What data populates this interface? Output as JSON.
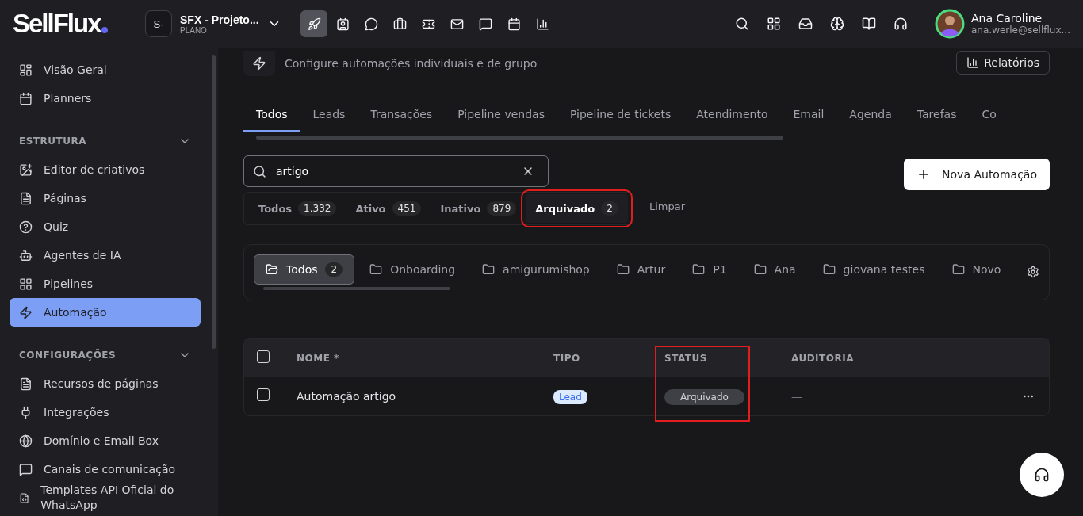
{
  "brand": {
    "logo": "SellFlux"
  },
  "workspace": {
    "initials": "S-",
    "name": "SFX - Projeto...",
    "plan": "PLANO"
  },
  "app_nav": [
    {
      "selected": true
    },
    {
      "selected": false
    },
    {
      "selected": false
    },
    {
      "selected": false
    },
    {
      "selected": false
    },
    {
      "selected": false
    },
    {
      "selected": false
    },
    {
      "selected": false
    },
    {
      "selected": false
    }
  ],
  "user": {
    "name": "Ana Caroline",
    "email": "ana.werle@sellflux..."
  },
  "sidebar": {
    "items": [
      {
        "kind": "item",
        "label": "Visão Geral",
        "selected": false
      },
      {
        "kind": "item",
        "label": "Planners",
        "selected": false
      },
      {
        "kind": "section",
        "label": "ESTRUTURA",
        "expanded": true
      },
      {
        "kind": "item",
        "label": "Editor de criativos",
        "selected": false
      },
      {
        "kind": "item",
        "label": "Páginas",
        "selected": false
      },
      {
        "kind": "item",
        "label": "Quiz",
        "selected": false
      },
      {
        "kind": "item",
        "label": "Agentes de IA",
        "selected": false
      },
      {
        "kind": "item",
        "label": "Pipelines",
        "selected": false
      },
      {
        "kind": "item",
        "label": "Automação",
        "selected": true
      },
      {
        "kind": "section",
        "label": "CONFIGURAÇÕES",
        "expanded": true
      },
      {
        "kind": "item",
        "label": "Recursos de páginas",
        "selected": false
      },
      {
        "kind": "item",
        "label": "Integrações",
        "selected": false
      },
      {
        "kind": "item",
        "label": "Domínio e Email Box",
        "selected": false
      },
      {
        "kind": "item",
        "label": "Canais de comunicação",
        "selected": false
      },
      {
        "kind": "item",
        "label": "Templates API Oficial do WhatsApp",
        "selected": false
      }
    ]
  },
  "page": {
    "subtitle": "Configure automações individuais e de grupo",
    "reports_button": "Relatórios"
  },
  "tabs": [
    {
      "label": "Todos",
      "selected": true
    },
    {
      "label": "Leads",
      "selected": false
    },
    {
      "label": "Transações",
      "selected": false
    },
    {
      "label": "Pipeline vendas",
      "selected": false
    },
    {
      "label": "Pipeline de tickets",
      "selected": false
    },
    {
      "label": "Atendimento",
      "selected": false
    },
    {
      "label": "Email",
      "selected": false
    },
    {
      "label": "Agenda",
      "selected": false
    },
    {
      "label": "Tarefas",
      "selected": false
    },
    {
      "label": "Co",
      "selected": false
    }
  ],
  "search": {
    "value": "artigo"
  },
  "status_filters": [
    {
      "label": "Todos",
      "count": "1.332",
      "selected": false,
      "highlighted": false
    },
    {
      "label": "Ativo",
      "count": "451",
      "selected": false,
      "highlighted": false
    },
    {
      "label": "Inativo",
      "count": "879",
      "selected": false,
      "highlighted": false
    },
    {
      "label": "Arquivado",
      "count": "2",
      "selected": true,
      "highlighted": true
    }
  ],
  "clear_filter": "Limpar",
  "new_button": "Nova Automação",
  "folders": [
    {
      "label": "Todos",
      "count": "2",
      "selected": true
    },
    {
      "label": "Onboarding",
      "selected": false
    },
    {
      "label": "amigurumishop",
      "selected": false
    },
    {
      "label": "Artur",
      "selected": false
    },
    {
      "label": "P1",
      "selected": false
    },
    {
      "label": "Ana",
      "selected": false
    },
    {
      "label": "giovana testes",
      "selected": false
    },
    {
      "label": "Novo",
      "selected": false
    }
  ],
  "table": {
    "select_all_checked": false,
    "columns": [
      {
        "label": "NOME *",
        "highlighted": false
      },
      {
        "label": "TIPO",
        "highlighted": false
      },
      {
        "label": "STATUS",
        "highlighted": true
      },
      {
        "label": "AUDITORIA",
        "highlighted": false
      }
    ],
    "rows": [
      {
        "checked": false,
        "name": "Automação artigo",
        "type": "Lead",
        "status": "Arquivado",
        "audit": "—"
      }
    ]
  }
}
